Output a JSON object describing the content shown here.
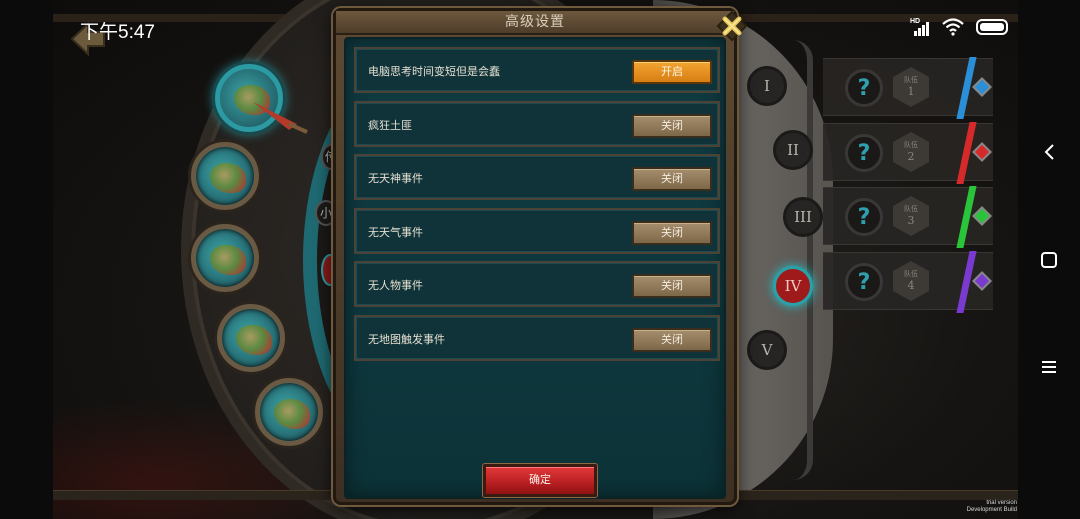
{
  "status_bar": {
    "time": "下午5:47",
    "network_badge": "HD",
    "icons": [
      "signal-icon",
      "wifi-icon",
      "battery-icon"
    ]
  },
  "modal": {
    "title": "高级设置",
    "options": [
      {
        "label": "电脑思考时间变短但是会蠢",
        "state": "开启",
        "enabled": true
      },
      {
        "label": "疯狂土匪",
        "state": "关闭",
        "enabled": false
      },
      {
        "label": "无天神事件",
        "state": "关闭",
        "enabled": false
      },
      {
        "label": "无天气事件",
        "state": "关闭",
        "enabled": false
      },
      {
        "label": "无人物事件",
        "state": "关闭",
        "enabled": false
      },
      {
        "label": "无地图触发事件",
        "state": "关闭",
        "enabled": false
      }
    ],
    "confirm_label": "确定"
  },
  "background": {
    "chapters": [
      "I",
      "II",
      "III",
      "IV",
      "V"
    ],
    "active_chapter": "IV",
    "teams": [
      {
        "label": "队伍",
        "number": "1",
        "color": "#2a8fd6"
      },
      {
        "label": "队伍",
        "number": "2",
        "color": "#d62a2a"
      },
      {
        "label": "队伍",
        "number": "3",
        "color": "#2ac43a"
      },
      {
        "label": "队伍",
        "number": "4",
        "color": "#7a3ad0"
      }
    ],
    "side_labels": [
      "小",
      "传"
    ]
  },
  "watermark": {
    "line1": "trial version",
    "line2": "Development Build"
  },
  "colors": {
    "toggle_on": "#e8931f",
    "toggle_off": "#927a59",
    "confirm": "#c82628",
    "panel_bg": "#0f3a40"
  }
}
